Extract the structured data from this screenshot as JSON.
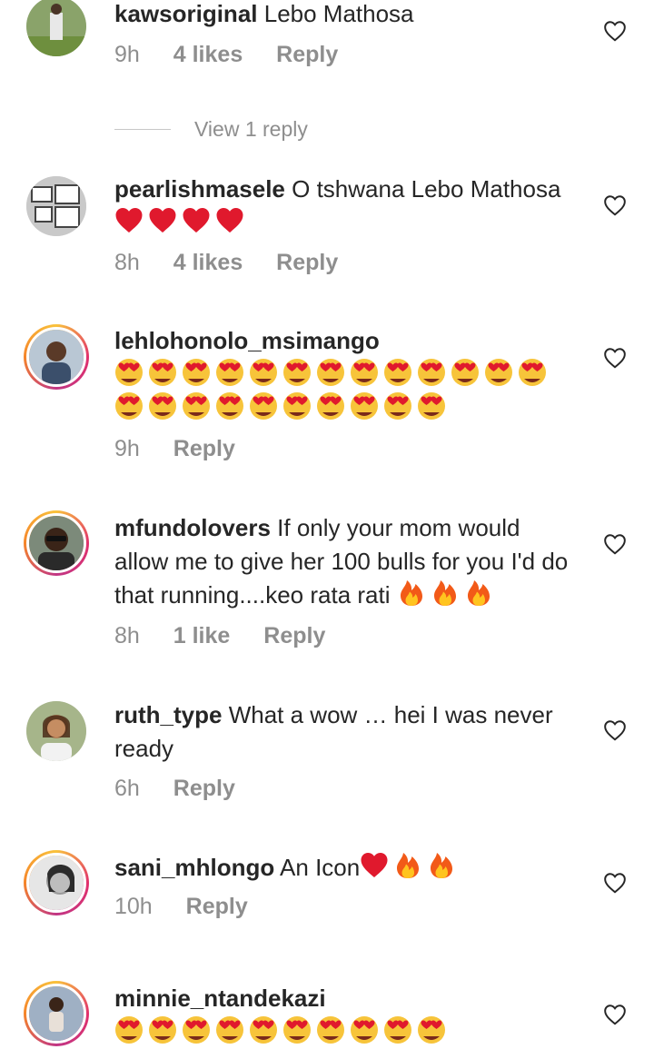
{
  "comments": [
    {
      "username": "kawsoriginal",
      "text": "Lebo Mathosa",
      "time": "9h",
      "likes": "4 likes",
      "reply": "Reply",
      "view_replies": "View 1 reply"
    },
    {
      "username": "pearlishmasele",
      "text": "O tshwana Lebo Mathosa",
      "time": "8h",
      "likes": "4 likes",
      "reply": "Reply"
    },
    {
      "username": "lehlohonolo_msimango",
      "text": "",
      "time": "9h",
      "reply": "Reply"
    },
    {
      "username": "mfundolovers",
      "text": "If only your mom would allow me to give her 100 bulls for you I'd do that running....keo rata rati",
      "time": "8h",
      "likes": "1 like",
      "reply": "Reply"
    },
    {
      "username": "ruth_type",
      "text": "What a wow … hei I was never ready",
      "time": "6h",
      "reply": "Reply"
    },
    {
      "username": "sani_mhlongo",
      "text": "An Icon",
      "time": "10h",
      "reply": "Reply"
    },
    {
      "username": "minnie_ntandekazi",
      "text": ""
    }
  ],
  "emoji_runs": {
    "c1": {
      "emoji": "heart",
      "count": 4
    },
    "c2_line1": {
      "emoji": "heart-eyes",
      "count": 13
    },
    "c2_line2": {
      "emoji": "heart-eyes",
      "count": 10
    },
    "c3": {
      "emoji": "fire",
      "count": 3
    },
    "c5": [
      {
        "emoji": "heart",
        "count": 1
      },
      {
        "emoji": "fire",
        "count": 2
      }
    ],
    "c6": {
      "emoji": "heart-eyes",
      "count": 10
    }
  },
  "icons": {
    "like": "heart-outline-icon"
  },
  "colors": {
    "text": "#262626",
    "muted": "#8e8e8e",
    "story_ring": "#e1306c"
  }
}
